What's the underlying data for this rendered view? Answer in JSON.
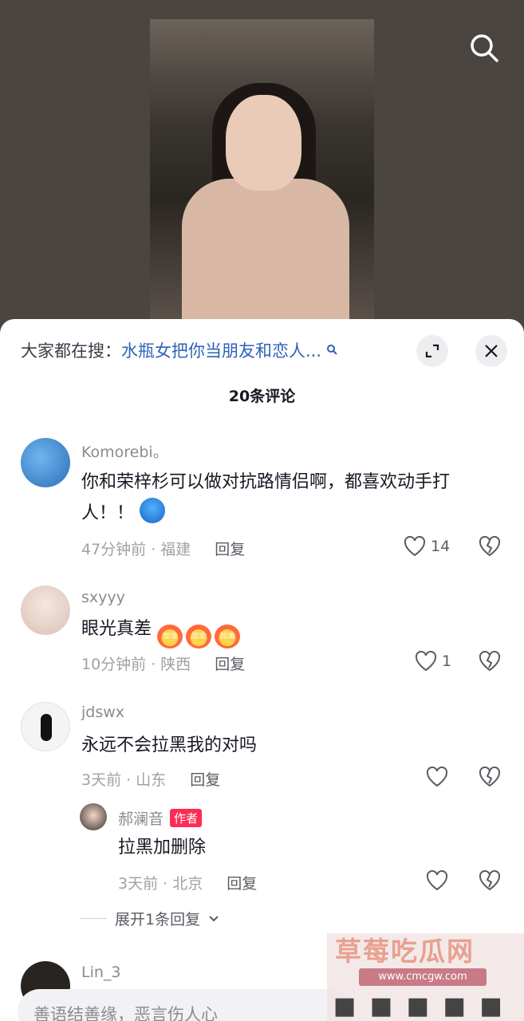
{
  "search_bar": {
    "prefix": "大家都在搜：",
    "query": "水瓶女把你当朋友和恋人..."
  },
  "comments_count": "20条评论",
  "comments": [
    {
      "username": "Komorebi。",
      "text_line1": "你和荣梓杉可以做对抗路情侣啊，都喜欢动手打",
      "text_line2": "人！！",
      "time_location": "47分钟前 · 福建",
      "reply_label": "回复",
      "likes": "14"
    },
    {
      "username": "sxyyy",
      "text": "眼光真差",
      "emoji_label": "加油",
      "time_location": "10分钟前 · 陕西",
      "reply_label": "回复",
      "likes": "1"
    },
    {
      "username": "jdswx",
      "text": "永远不会拉黑我的对吗",
      "time_location": "3天前 · 山东",
      "reply_label": "回复",
      "likes": ""
    }
  ],
  "author_reply": {
    "username": "郝澜音",
    "tag": "作者",
    "text": "拉黑加删除",
    "time_location": "3天前 · 北京",
    "reply_label": "回复"
  },
  "expand_replies": "展开1条回复",
  "partial_username": "Lin_3",
  "input_placeholder": "善语结善缘，恶言伤人心",
  "watermark": {
    "title": "草莓吃瓜网",
    "url": "www.cmcgw.com"
  },
  "colors": {
    "link": "#2c63b8",
    "author_tag": "#fe2c55"
  }
}
